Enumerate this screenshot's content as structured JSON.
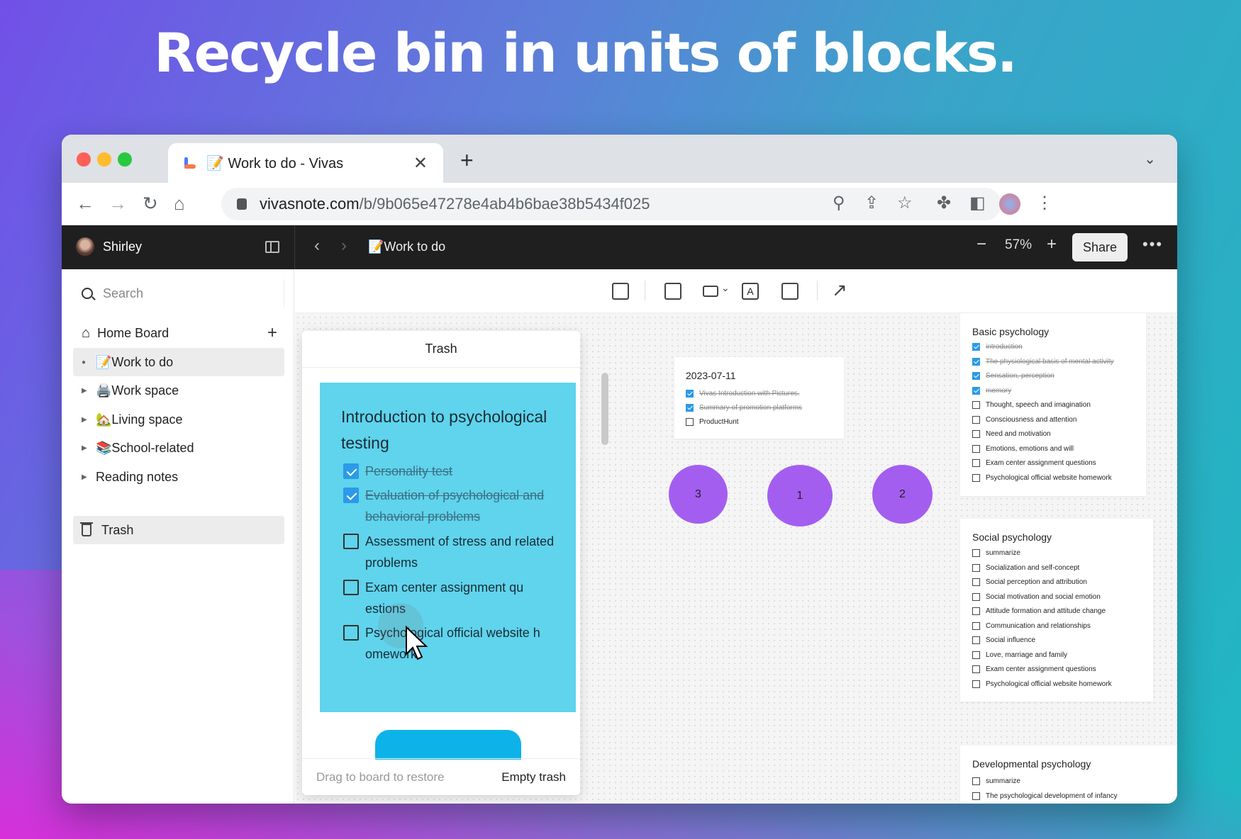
{
  "headline": "Recycle bin in units of blocks.",
  "browser": {
    "tab_title": "📝 Work to do - Vivas",
    "url_host": "vivasnote.com",
    "url_path": "/b/9b065e47278e4ab4b6bae38b5434f025"
  },
  "app": {
    "user_name": "Shirley",
    "breadcrumb": "📝Work to do",
    "zoom_level": "57%",
    "share_label": "Share"
  },
  "sidebar": {
    "search_placeholder": "Search",
    "home_board": "Home Board",
    "items": [
      {
        "label": "📝Work to do",
        "active": true
      },
      {
        "label": "🖨️Work space"
      },
      {
        "label": "🏡Living space"
      },
      {
        "label": "📚School-related"
      },
      {
        "label": "Reading notes"
      }
    ],
    "trash_label": "Trash"
  },
  "trash_panel": {
    "title": "Trash",
    "card_title": "Introduction to psychological testing",
    "items": [
      {
        "label": "Personality test",
        "checked": true
      },
      {
        "label": "Evaluation of psychological and behavioral problems",
        "checked": true
      },
      {
        "label": "Assessment of stress and related problems",
        "checked": false
      },
      {
        "label": "Exam center assignment qu estions",
        "checked": false
      },
      {
        "label": "Psychological official website h omework",
        "checked": false
      }
    ],
    "hint": "Drag to board to restore",
    "empty_label": "Empty trash"
  },
  "board": {
    "date_note": {
      "title": "2023-07-11",
      "items": [
        {
          "label": "Vivas Introduction with Pictures.",
          "checked": true
        },
        {
          "label": "Summary of promotion platforms",
          "checked": true
        },
        {
          "label": "ProductHunt",
          "checked": false
        }
      ]
    },
    "circles": [
      "3",
      "1",
      "2"
    ],
    "basic": {
      "title": "Basic psychology",
      "items": [
        {
          "label": "introduction",
          "checked": true
        },
        {
          "label": "The physiological basis of mental activity",
          "checked": true
        },
        {
          "label": "Sensation, perception",
          "checked": true
        },
        {
          "label": "memory",
          "checked": true
        },
        {
          "label": "Thought, speech and imagination",
          "checked": false
        },
        {
          "label": "Consciousness and attention",
          "checked": false
        },
        {
          "label": "Need and motivation",
          "checked": false
        },
        {
          "label": "Emotions, emotions and will",
          "checked": false
        },
        {
          "label": "Exam center assignment questions",
          "checked": false
        },
        {
          "label": "Psychological official website homework",
          "checked": false
        }
      ]
    },
    "social": {
      "title": "Social psychology",
      "items": [
        {
          "label": "summarize",
          "checked": false
        },
        {
          "label": "Socialization and self-concept",
          "checked": false
        },
        {
          "label": "Social perception and attribution",
          "checked": false
        },
        {
          "label": "Social motivation and social emotion",
          "checked": false
        },
        {
          "label": "Attitude formation and attitude change",
          "checked": false
        },
        {
          "label": "Communication and relationships",
          "checked": false
        },
        {
          "label": "Social influence",
          "checked": false
        },
        {
          "label": "Love, marriage and family",
          "checked": false
        },
        {
          "label": "Exam center assignment questions",
          "checked": false
        },
        {
          "label": "Psychological official website homework",
          "checked": false
        }
      ]
    },
    "developmental": {
      "title": "Developmental psychology",
      "items": [
        {
          "label": "summarize",
          "checked": false
        },
        {
          "label": "The psychological development of infancy",
          "checked": false
        }
      ]
    }
  },
  "colors": {
    "card": "#5fd4ec",
    "circle": "#a35ef0",
    "checkbox": "#2b9ae8",
    "appbar": "#1f1f1f"
  }
}
